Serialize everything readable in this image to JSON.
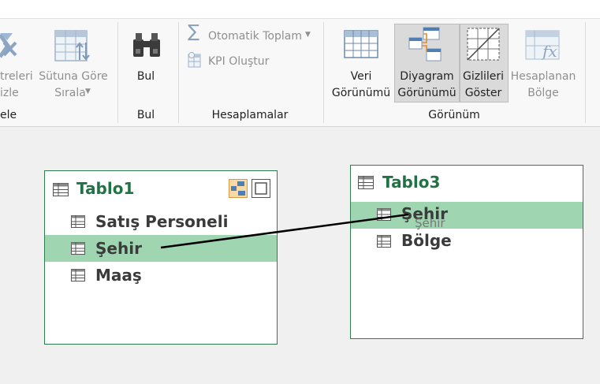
{
  "ribbon": {
    "filter_group": {
      "button_line1": "treleri",
      "button_line2": "izle",
      "group_label": "ele"
    },
    "sort_by_column": {
      "line1": "Sütuna Göre",
      "line2": "Sırala"
    },
    "find": {
      "button_label": "Bul",
      "group_label": "Bul"
    },
    "calculations": {
      "autosum_label": "Otomatik Toplam",
      "kpi_label": "KPI Oluştur",
      "group_label": "Hesaplamalar"
    },
    "view": {
      "data_view": {
        "line1": "Veri",
        "line2": "Görünümü"
      },
      "diagram_view": {
        "line1": "Diyagram",
        "line2": "Görünümü"
      },
      "show_hidden": {
        "line1": "Gizlileri",
        "line2": "Göster"
      },
      "calculation_area": {
        "line1": "Hesaplanan",
        "line2": "Bölge"
      },
      "group_label": "Görünüm"
    }
  },
  "diagram": {
    "tables": [
      {
        "title": "Tablo1",
        "fields": [
          "Satış Personeli",
          "Şehir",
          "Maaş"
        ],
        "highlighted_field": "Şehir"
      },
      {
        "title": "Tablo3",
        "fields": [
          "Şehir",
          "Bölge"
        ],
        "highlighted_field": "Şehir"
      }
    ],
    "drag_ghost_label": "Şehir"
  },
  "colors": {
    "accent_green": "#217346",
    "highlight": "#9fd5b1",
    "border_green": "#2f7d4f"
  }
}
